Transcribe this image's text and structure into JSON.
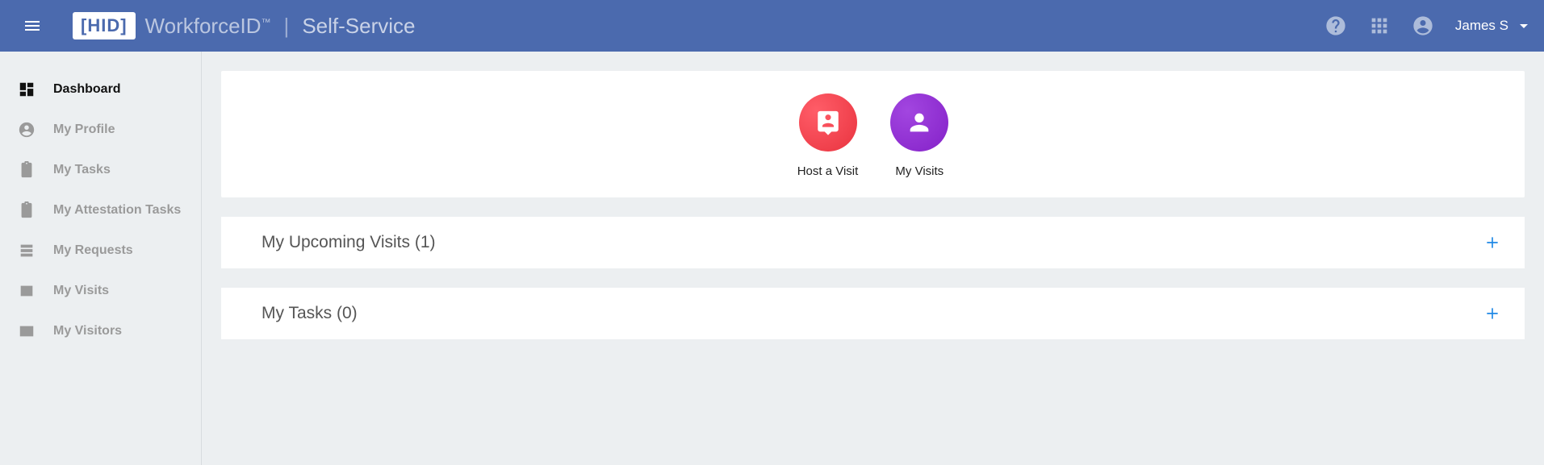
{
  "header": {
    "brand": "WorkforceID",
    "subtitle": "Self-Service",
    "userName": "James S"
  },
  "sidebar": {
    "items": [
      {
        "label": "Dashboard",
        "active": true
      },
      {
        "label": "My Profile"
      },
      {
        "label": "My Tasks"
      },
      {
        "label": "My Attestation Tasks"
      },
      {
        "label": "My Requests"
      },
      {
        "label": "My Visits"
      },
      {
        "label": "My Visitors"
      }
    ]
  },
  "actions": {
    "hostVisit": "Host a Visit",
    "myVisits": "My Visits"
  },
  "panels": {
    "upcomingVisits": "My Upcoming Visits (1)",
    "myTasks": "My Tasks (0)"
  }
}
